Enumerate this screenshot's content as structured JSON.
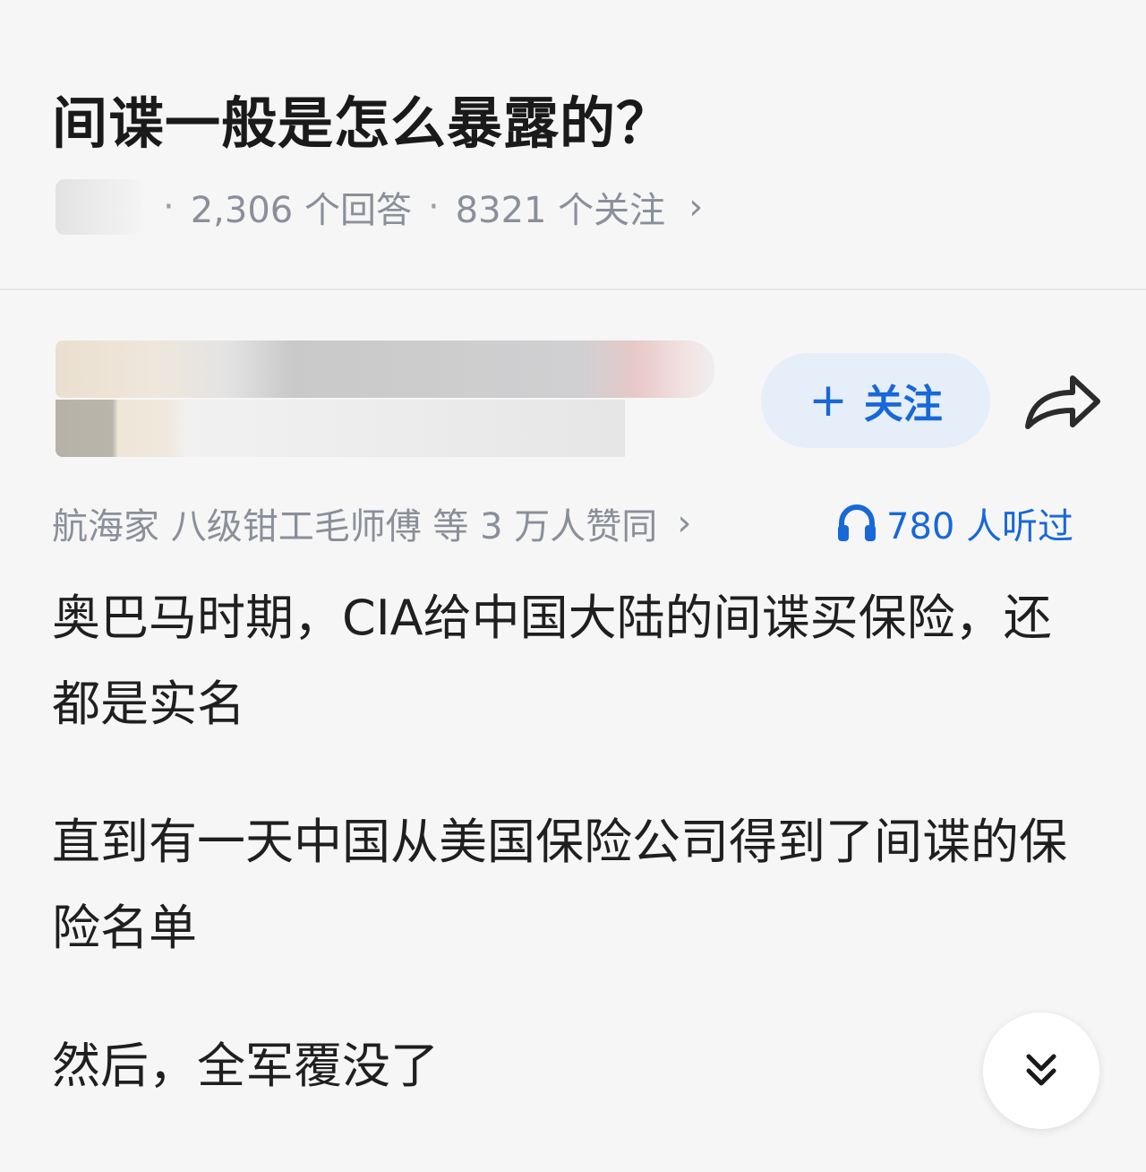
{
  "question": {
    "title": "间谍一般是怎么暴露的？",
    "meta": {
      "dot": "·",
      "answers": "2,306 个回答",
      "followers": "8321 个关注",
      "chevron": "›"
    }
  },
  "answer": {
    "follow_plus": "+",
    "follow_label": "关注",
    "upvoters": "航海家 八级钳工毛师傅 等 3 万人赞同",
    "upvote_chevron": "›",
    "listen_count": "780 人听过",
    "paragraphs": [
      "奥巴马时期，CIA给中国大陆的间谍买保险，还都是实名",
      "直到有一天中国从美国保险公司得到了间谍的保险名单",
      "然后，全军覆没了"
    ]
  },
  "icons": {
    "share": "share-icon",
    "headphone": "headphone-icon",
    "expand": "double-chevron-down-icon"
  },
  "colors": {
    "accent": "#1768d8",
    "follow_bg": "#e6eef9",
    "meta_text": "#8a8f99",
    "background": "#f6f6f6"
  }
}
